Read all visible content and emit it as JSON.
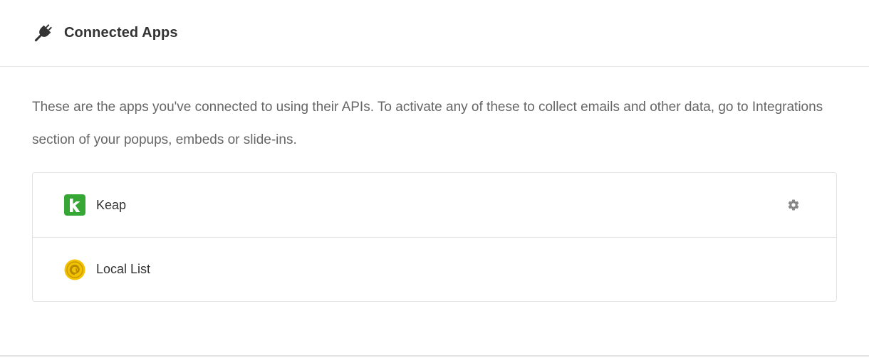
{
  "header": {
    "title": "Connected Apps",
    "icon": "plug-icon"
  },
  "description": "These are the apps you've connected to using their APIs. To activate any of these to collect emails and other data, go to Integrations section of your popups, embeds or slide-ins.",
  "apps": [
    {
      "name": "Keap",
      "logo": "keap-logo",
      "brand_color": "#36a635",
      "has_settings": true,
      "settings_icon": "gear-icon"
    },
    {
      "name": "Local List",
      "logo": "local-list-logo",
      "brand_color": "#f2c200",
      "has_settings": false
    }
  ],
  "colors": {
    "title_text": "#333333",
    "body_text": "#666666",
    "border": "#e3e3e3",
    "icon_gray": "#888888"
  }
}
